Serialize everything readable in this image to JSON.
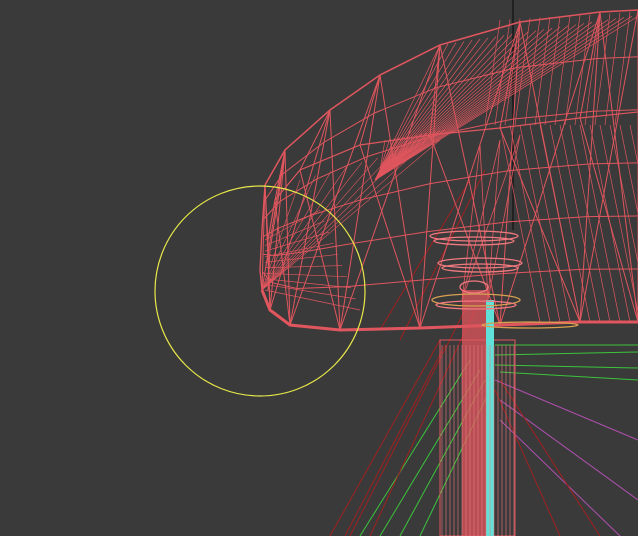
{
  "viewport": {
    "background": "#3a3a3a",
    "mesh_color": "#e0565e",
    "mesh_highlight": "#f07a80",
    "gizmo_color": "#e8e84a",
    "cyan_color": "#5fe0d8",
    "green_color": "#3cc43c",
    "purple_color": "#b050b0",
    "darkred_color": "#a02020",
    "orange_color": "#d8a050"
  }
}
